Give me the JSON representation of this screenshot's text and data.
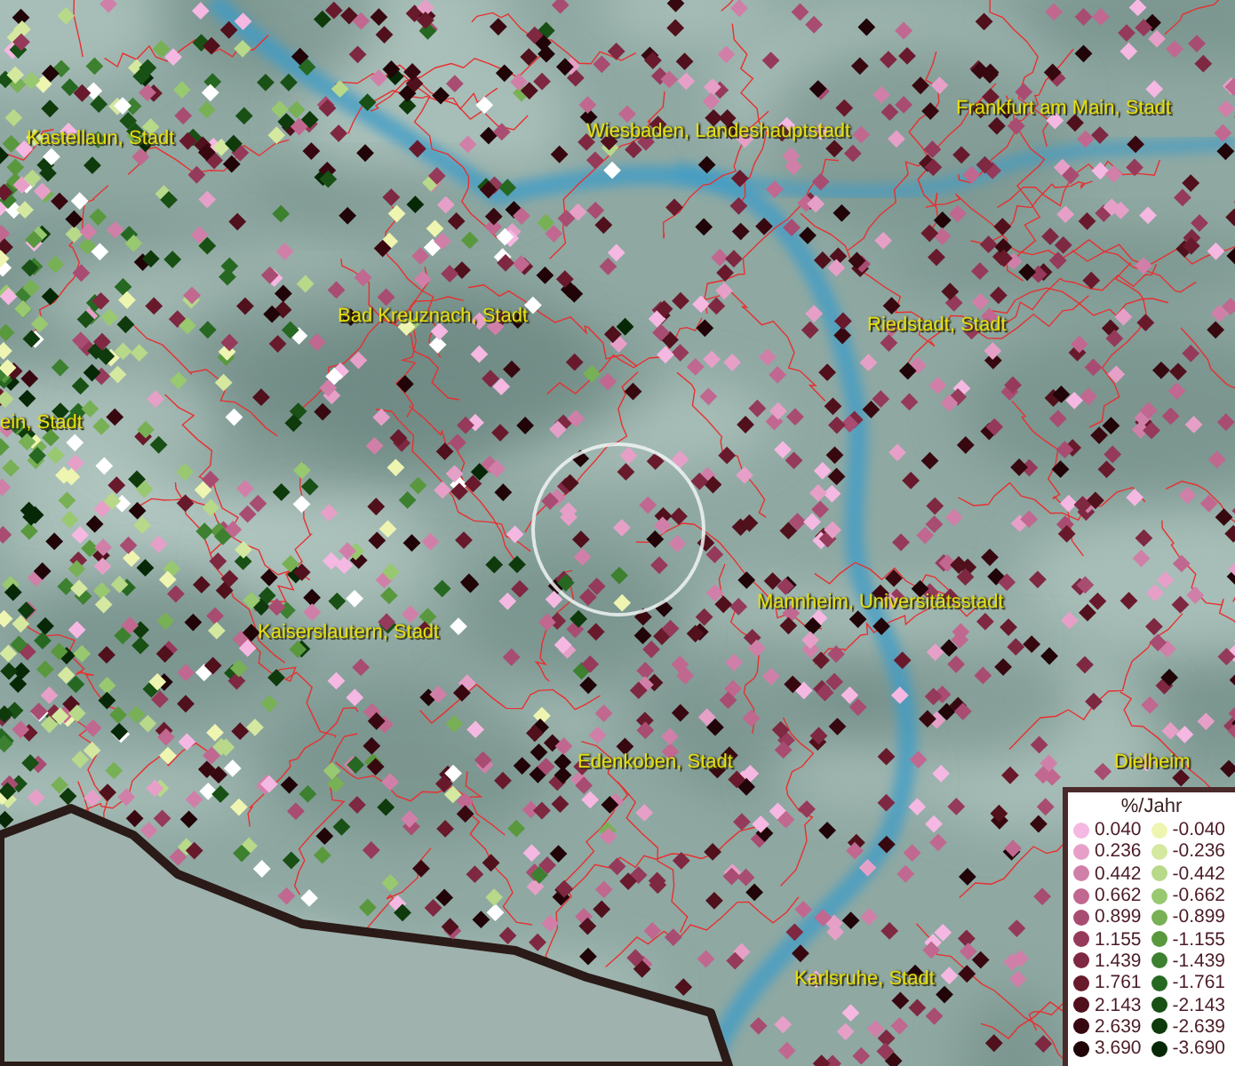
{
  "map": {
    "place_labels": [
      {
        "text": "Kastellaun, Stadt"
      },
      {
        "text": "Wiesbaden, Landeshauptstadt"
      },
      {
        "text": "Frankfurt am Main, Stadt"
      },
      {
        "text": "Bad Kreuznach, Stadt"
      },
      {
        "text": "Riedstadt, Stadt"
      },
      {
        "text": "ein, Stadt"
      },
      {
        "text": "Kaiserslautern, Stadt"
      },
      {
        "text": "Mannheim, Universitätsstadt"
      },
      {
        "text": "Edenkoben, Stadt"
      },
      {
        "text": "Dielheim"
      },
      {
        "text": "Karlsruhe, Stadt"
      }
    ]
  },
  "legend": {
    "title": "%/Jahr",
    "positive": [
      {
        "label": "0.040",
        "color": "#f5b8e2"
      },
      {
        "label": "0.236",
        "color": "#e6a0c8"
      },
      {
        "label": "0.442",
        "color": "#d080a8"
      },
      {
        "label": "0.662",
        "color": "#c06890"
      },
      {
        "label": "0.899",
        "color": "#a84c72"
      },
      {
        "label": "1.155",
        "color": "#953a5a"
      },
      {
        "label": "1.439",
        "color": "#7e2842"
      },
      {
        "label": "1.761",
        "color": "#681a2c"
      },
      {
        "label": "2.143",
        "color": "#50101c"
      },
      {
        "label": "2.639",
        "color": "#380810"
      },
      {
        "label": "3.690",
        "color": "#200408"
      }
    ],
    "negative": [
      {
        "label": "-0.040",
        "color": "#eef5b0"
      },
      {
        "label": "-0.236",
        "color": "#d4e8a0"
      },
      {
        "label": "-0.442",
        "color": "#b8d88a"
      },
      {
        "label": "-0.662",
        "color": "#98c870"
      },
      {
        "label": "-0.899",
        "color": "#78b055"
      },
      {
        "label": "-1.155",
        "color": "#5a983e"
      },
      {
        "label": "-1.439",
        "color": "#3c8030"
      },
      {
        "label": "-1.761",
        "color": "#266822"
      },
      {
        "label": "-2.143",
        "color": "#185015"
      },
      {
        "label": "-2.639",
        "color": "#0e3a0c"
      },
      {
        "label": "-3.690",
        "color": "#062806"
      }
    ]
  }
}
